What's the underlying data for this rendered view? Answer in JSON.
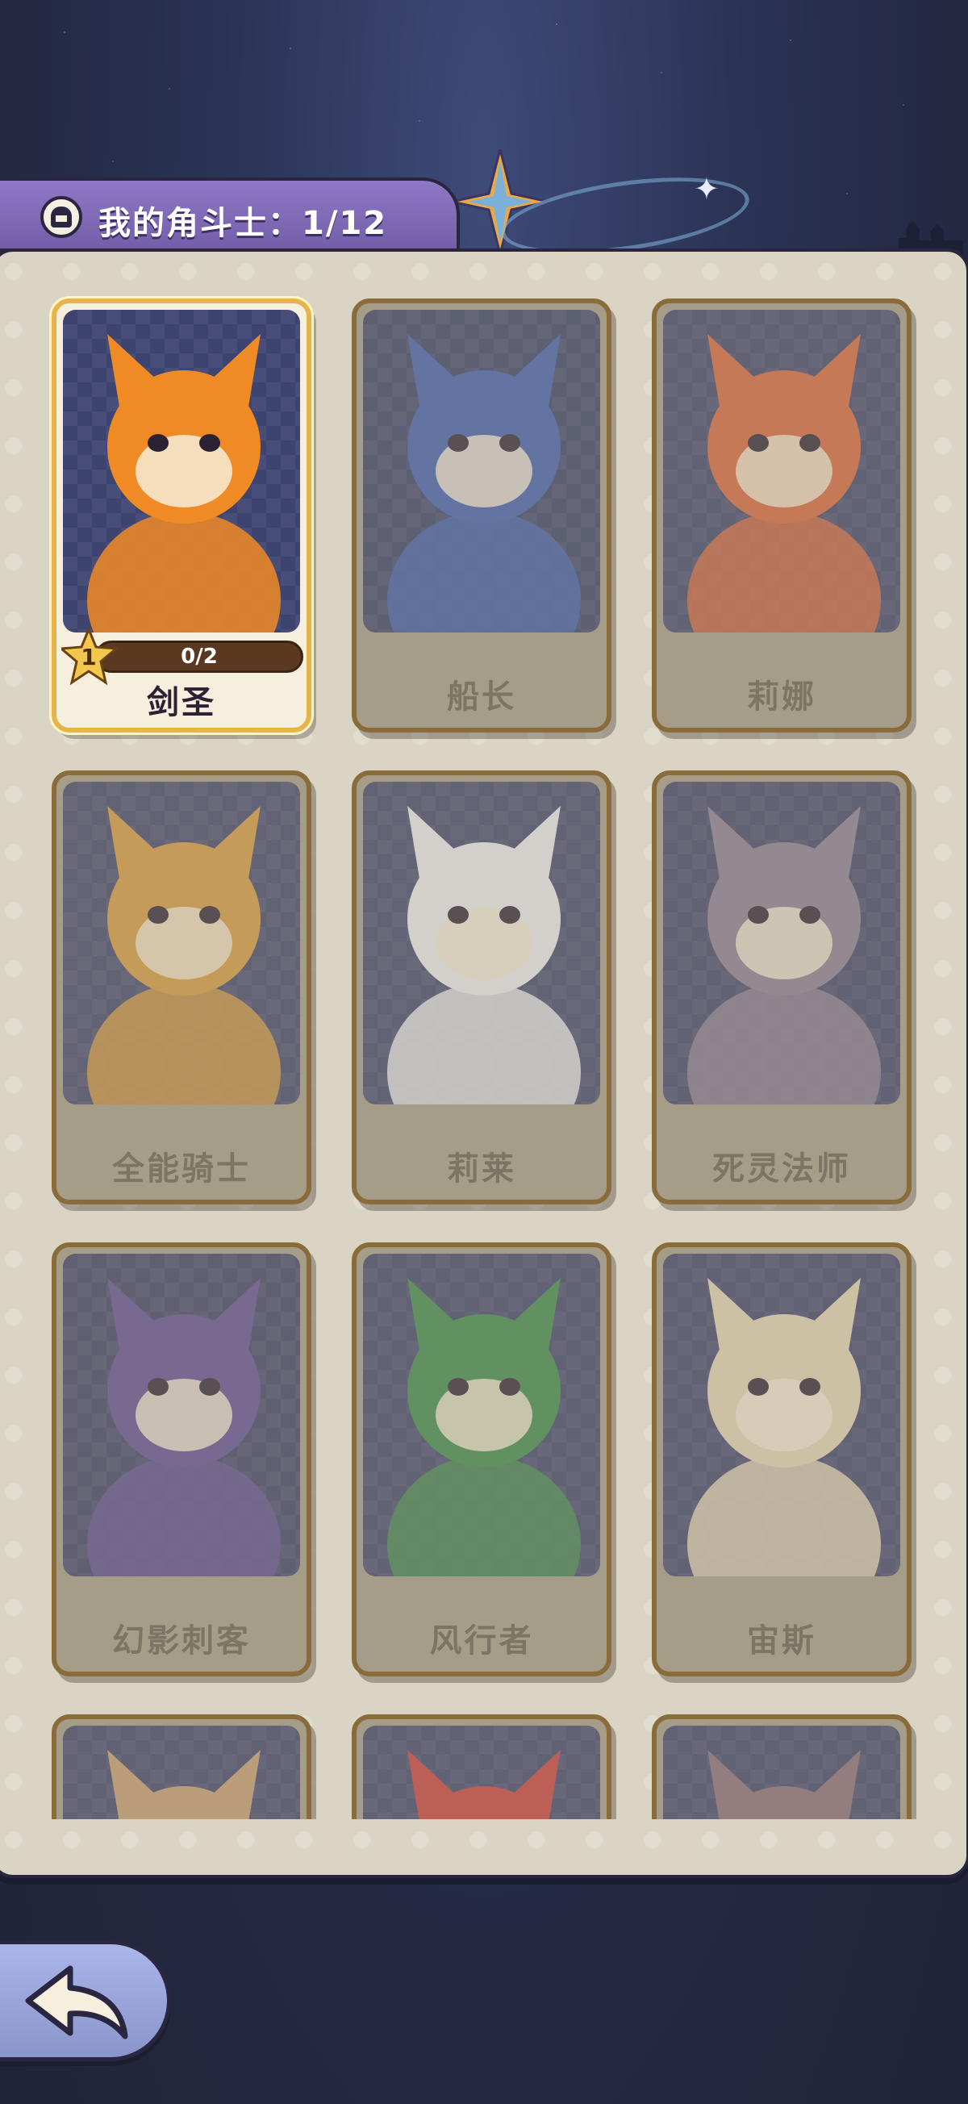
{
  "header": {
    "title": "我的角斗士：1/12",
    "icon": "helmet-icon"
  },
  "fighters": [
    {
      "name": "剑圣",
      "unlocked": true,
      "level": "1",
      "progress": "0/2",
      "accent": "#f08a24",
      "bg": "#3e4470"
    },
    {
      "name": "船长",
      "unlocked": false,
      "accent": "#3b5bb5",
      "bg": "#323a66"
    },
    {
      "name": "莉娜",
      "unlocked": false,
      "accent": "#d9643a",
      "bg": "#3a3f6a"
    },
    {
      "name": "全能骑士",
      "unlocked": false,
      "accent": "#d79a3c",
      "bg": "#3a406b"
    },
    {
      "name": "莉莱",
      "unlocked": false,
      "accent": "#f0f0f5",
      "bg": "#3a406b"
    },
    {
      "name": "死灵法师",
      "unlocked": false,
      "accent": "#8a7e96",
      "bg": "#3a3f69"
    },
    {
      "name": "幻影刺客",
      "unlocked": false,
      "accent": "#5b4a96",
      "bg": "#363b66"
    },
    {
      "name": "风行者",
      "unlocked": false,
      "accent": "#3a8a4a",
      "bg": "#3a3f6a"
    },
    {
      "name": "宙斯",
      "unlocked": false,
      "accent": "#e6d8b8",
      "bg": "#3a3f6a"
    },
    {
      "name": "",
      "unlocked": false,
      "accent": "#c8a070",
      "bg": "#3a3f6a"
    },
    {
      "name": "",
      "unlocked": false,
      "accent": "#c83a3a",
      "bg": "#3a3f6a"
    },
    {
      "name": "",
      "unlocked": false,
      "accent": "#8a6a78",
      "bg": "#3a3f6a"
    }
  ],
  "back_button": {
    "icon": "back-arrow-icon"
  }
}
